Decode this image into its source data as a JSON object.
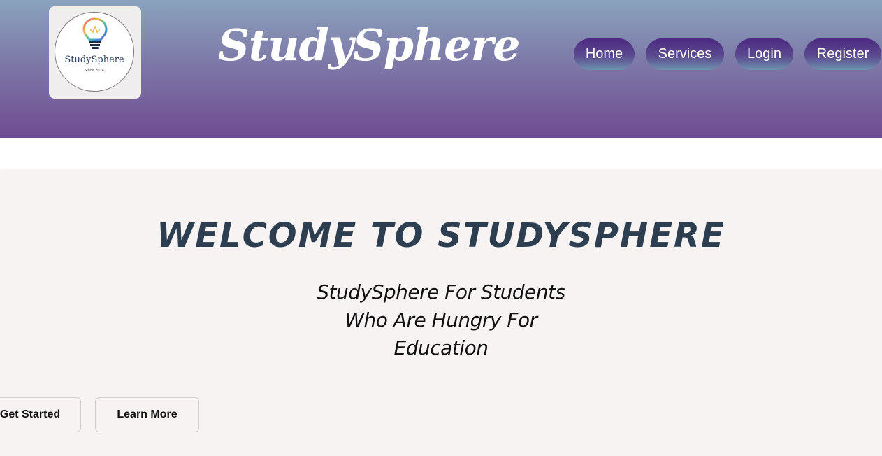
{
  "header": {
    "logo": {
      "name": "StudySphere",
      "since": "Since 2024"
    },
    "brand_title": "StudySphere",
    "nav": [
      {
        "label": "Home"
      },
      {
        "label": "Services"
      },
      {
        "label": "Login"
      },
      {
        "label": "Register"
      }
    ]
  },
  "hero": {
    "title": "WELCOME TO STUDYSPHERE",
    "subtitle_lines": [
      "StudySphere For Students",
      "Who Are Hungry For",
      "Education"
    ],
    "buttons": [
      {
        "label": "Get Started"
      },
      {
        "label": "Learn More"
      }
    ]
  },
  "colors": {
    "header_gradient_top": "#8aa2bd",
    "header_gradient_bottom": "#6f4c91",
    "nav_button": "#4d2a82",
    "hero_background": "#f7f3f2",
    "hero_title": "#2d3e50"
  },
  "icons": {
    "logo_icon": "lightbulb-icon"
  }
}
